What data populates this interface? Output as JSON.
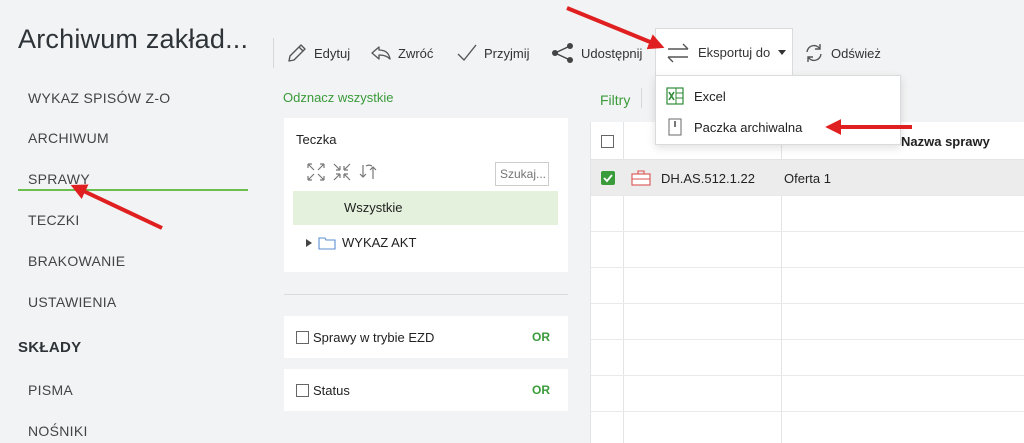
{
  "app": {
    "title": "Archiwum zakład..."
  },
  "sidebar": {
    "items": [
      {
        "label": "WYKAZ SPISÓW Z-O"
      },
      {
        "label": "ARCHIWUM"
      },
      {
        "label": "SPRAWY"
      },
      {
        "label": "TECZKI"
      },
      {
        "label": "BRAKOWANIE"
      },
      {
        "label": "USTAWIENIA"
      }
    ],
    "section": "SKŁADY",
    "section_items": [
      {
        "label": "PISMA"
      },
      {
        "label": "NOŚNIKI"
      }
    ]
  },
  "toolbar": {
    "edit": "Edytuj",
    "return": "Zwróć",
    "accept": "Przyjmij",
    "share": "Udostępnij",
    "export": "Eksportuj do",
    "refresh": "Odśwież"
  },
  "export_menu": {
    "items": [
      {
        "label": "Excel",
        "icon": "excel-icon"
      },
      {
        "label": "Paczka archiwalna",
        "icon": "archive-package-icon"
      }
    ]
  },
  "filters_panel": {
    "select_all": "Odznacz wszystkie",
    "folder_tree": {
      "label": "Teczka",
      "search_placeholder": "Szukaj...",
      "all_node": "Wszystkie",
      "nodes": [
        {
          "label": "WYKAZ AKT"
        }
      ]
    },
    "filters": [
      {
        "label": "Sprawy w trybie EZD",
        "operator": "OR"
      },
      {
        "label": "Status",
        "operator": "OR"
      }
    ]
  },
  "table": {
    "filters_label": "Filtry",
    "columns": {
      "name": "Nazwa sprawy"
    },
    "rows": [
      {
        "signature": "DH.AS.512.1.22",
        "name": "Oferta 1",
        "selected": true
      }
    ]
  },
  "colors": {
    "accent": "#3a9b3a",
    "selected_node_bg": "#e4f1dc",
    "annotation": "#e02020"
  }
}
